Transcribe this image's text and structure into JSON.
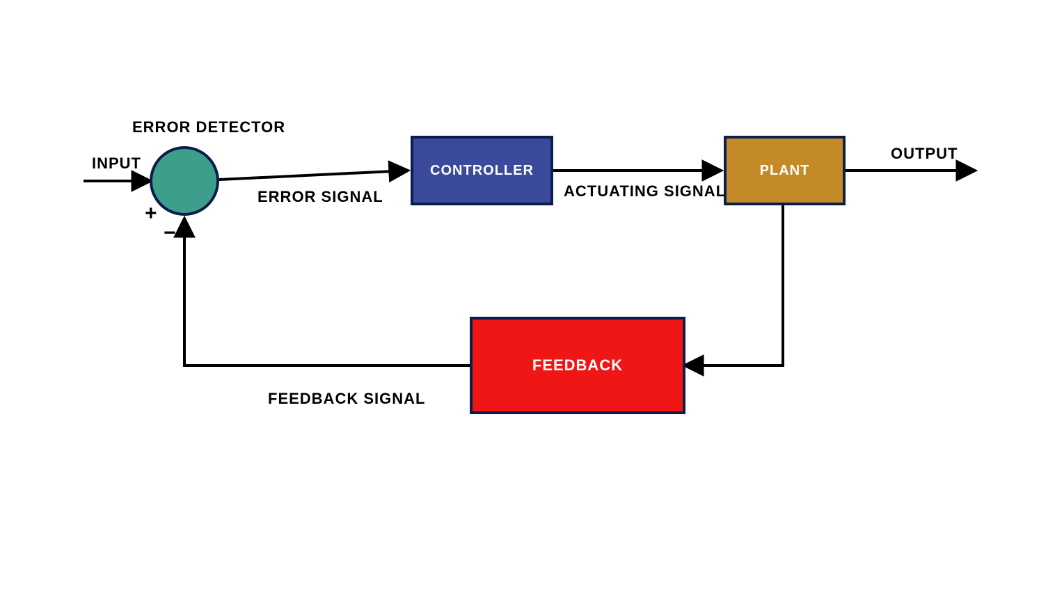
{
  "labels": {
    "input": "INPUT",
    "output": "OUTPUT",
    "error_detector": "ERROR DETECTOR",
    "error_signal": "ERROR SIGNAL",
    "actuating_signal": "ACTUATING SIGNAL",
    "feedback_signal": "FEEDBACK SIGNAL",
    "plus": "+",
    "minus": "−"
  },
  "blocks": {
    "controller": {
      "label": "CONTROLLER",
      "fill": "#3b4a9a"
    },
    "plant": {
      "label": "PLANT",
      "fill": "#c48a27"
    },
    "feedback": {
      "label": "FEEDBACK",
      "fill": "#f01616"
    }
  },
  "summing_junction": {
    "fill": "#3d9f8b"
  },
  "colors": {
    "stroke": "#0b1e4b",
    "text": "#000000",
    "arrow": "#000000"
  }
}
